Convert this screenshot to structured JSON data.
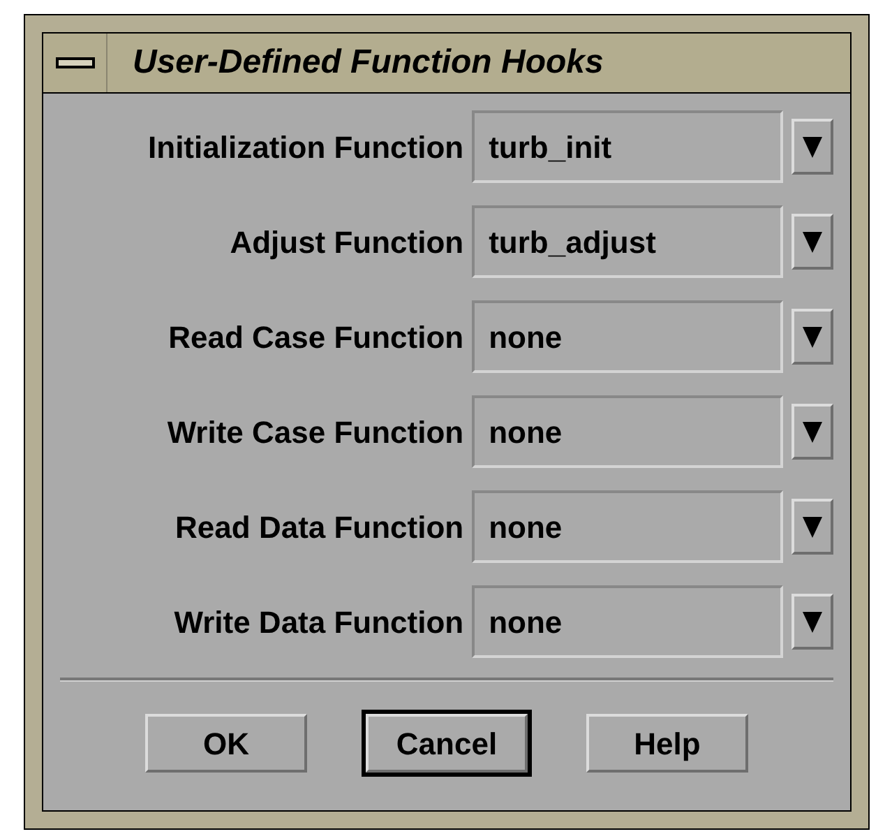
{
  "window": {
    "title": "User-Defined Function Hooks"
  },
  "fields": [
    {
      "label": "Initialization Function",
      "value": "turb_init"
    },
    {
      "label": "Adjust Function",
      "value": "turb_adjust"
    },
    {
      "label": "Read Case Function",
      "value": "none"
    },
    {
      "label": "Write Case Function",
      "value": "none"
    },
    {
      "label": "Read Data Function",
      "value": "none"
    },
    {
      "label": "Write Data Function",
      "value": "none"
    }
  ],
  "buttons": [
    {
      "label": "OK",
      "default": false
    },
    {
      "label": "Cancel",
      "default": true
    },
    {
      "label": "Help",
      "default": false
    }
  ]
}
